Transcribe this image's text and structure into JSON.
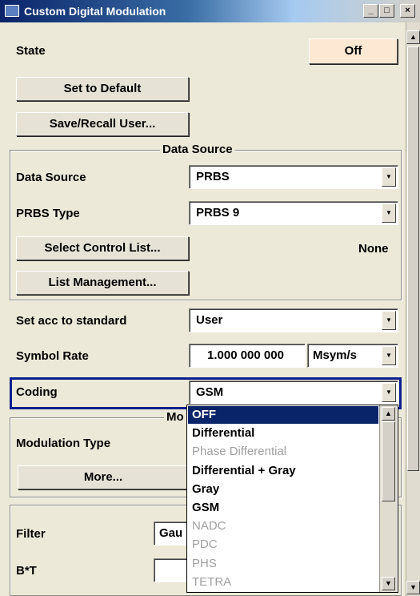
{
  "window": {
    "title": "Custom Digital Modulation",
    "minimize_glyph": "_",
    "maximize_glyph": "□",
    "close_glyph": "×"
  },
  "state": {
    "label": "State",
    "value": "Off"
  },
  "buttons": {
    "set_default": "Set to Default",
    "save_recall": "Save/Recall User..."
  },
  "data_source_group": {
    "legend": "Data Source",
    "data_source_label": "Data Source",
    "data_source_value": "PRBS",
    "prbs_type_label": "PRBS Type",
    "prbs_type_value": "PRBS 9",
    "select_control_list": "Select Control List...",
    "control_list_value": "None",
    "list_management": "List Management..."
  },
  "standard": {
    "label": "Set acc to standard",
    "value": "User"
  },
  "symbol_rate": {
    "label": "Symbol Rate",
    "value": "1.000 000 000",
    "unit": "Msym/s"
  },
  "coding": {
    "label": "Coding",
    "value": "GSM"
  },
  "modulation_group": {
    "legend_partial": "Mo",
    "modulation_type_label": "Modulation Type",
    "more_button": "More..."
  },
  "filter_group": {
    "filter_label": "Filter",
    "filter_value_partial": "Gau",
    "bt_label": "B*T"
  },
  "dropdown": {
    "options": [
      {
        "label": "OFF",
        "state": "selected"
      },
      {
        "label": "Differential",
        "state": "enabled"
      },
      {
        "label": "Phase Differential",
        "state": "disabled"
      },
      {
        "label": "Differential + Gray",
        "state": "enabled"
      },
      {
        "label": "Gray",
        "state": "enabled"
      },
      {
        "label": "GSM",
        "state": "enabled"
      },
      {
        "label": "NADC",
        "state": "disabled"
      },
      {
        "label": "PDC",
        "state": "disabled"
      },
      {
        "label": "PHS",
        "state": "disabled"
      },
      {
        "label": "TETRA",
        "state": "disabled"
      }
    ]
  },
  "icons": {
    "arrow_down": "▼",
    "arrow_up": "▲"
  },
  "colors": {
    "highlight": "#0a246a",
    "state_button": "#fde8d4",
    "focus_border": "#0a1f8f"
  }
}
